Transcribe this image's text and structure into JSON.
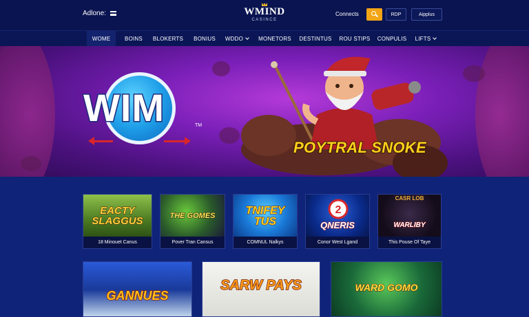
{
  "header": {
    "brand_left": "Adlone:",
    "logo": "WMIND",
    "logo_sub": "CASINCE",
    "link": "Connects",
    "btn_rdp": "RDP",
    "btn_apply": "Aipplus"
  },
  "nav": {
    "items": [
      {
        "label": "WOME",
        "active": true
      },
      {
        "label": "BOINS"
      },
      {
        "label": "BLOKERTS"
      },
      {
        "label": "BONIUS"
      },
      {
        "label": "WDDO",
        "dropdown": true
      },
      {
        "label": "MONETORS"
      },
      {
        "label": "DESTINTUS"
      },
      {
        "label": "ROU STIPS"
      },
      {
        "label": "CONPULIS"
      },
      {
        "label": "LIFTS",
        "dropdown": true
      }
    ]
  },
  "hero": {
    "logo_text": "WIM",
    "tm": "TM",
    "tagline": "POYTRAL SNOKE"
  },
  "games": [
    {
      "art_title": "EACTY SLAGGUS",
      "caption": "18 Minouet Canus"
    },
    {
      "art_title": "THE GOMES",
      "caption": "Pover Tran Cansus"
    },
    {
      "art_title": "TNIFEY TUS",
      "caption": "COMNUL Nalkys"
    },
    {
      "art_title": "QNERIS",
      "caption": "Conor West Lgand"
    },
    {
      "art_title": "WARLIBY",
      "art_top": "CASR LOB",
      "caption": "This Pouse Of Taye"
    },
    {
      "art_title": "GANNUES"
    },
    {
      "art_title": "SARW PAYS"
    },
    {
      "art_title": "WARD GOMO"
    }
  ]
}
